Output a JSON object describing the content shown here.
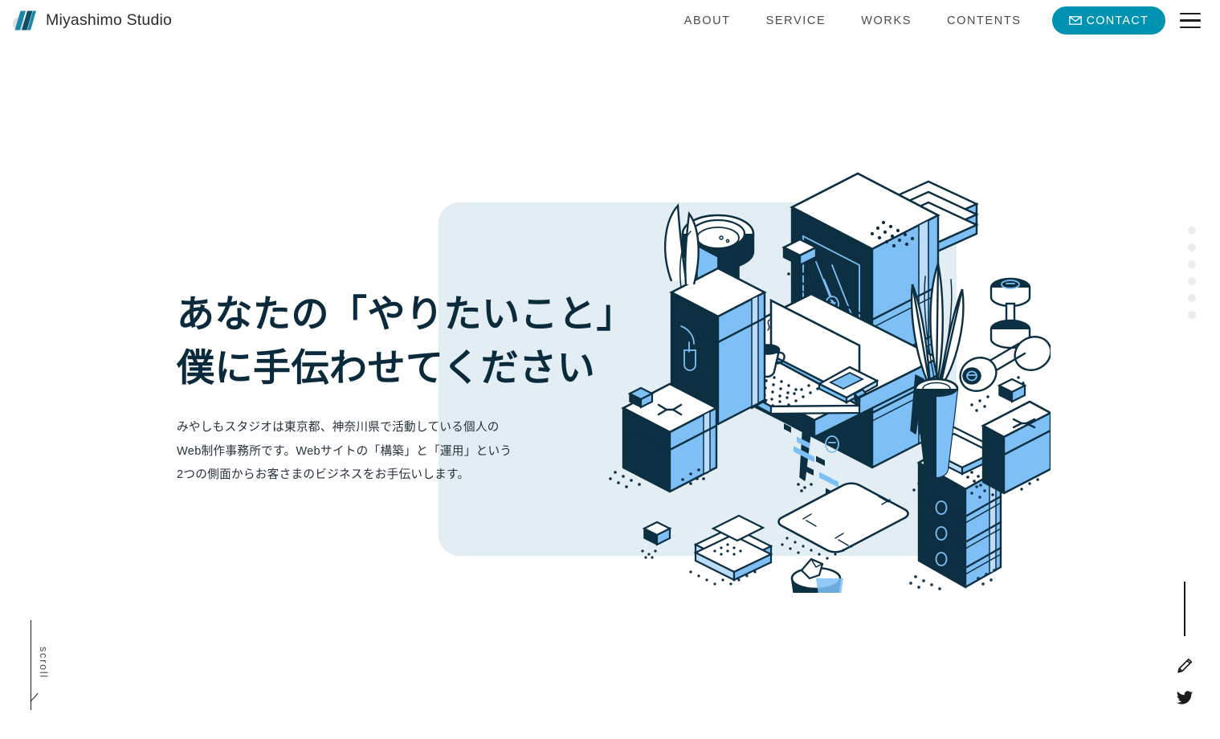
{
  "brand": {
    "name": "Miyashimo Studio",
    "logo_icon": "logo-slashes-icon",
    "accent": "#0092b1",
    "logo_circle": "#dedede"
  },
  "nav": {
    "items": [
      {
        "label": "ABOUT",
        "name": "nav-about"
      },
      {
        "label": "SERVICE",
        "name": "nav-service"
      },
      {
        "label": "WORKS",
        "name": "nav-works"
      },
      {
        "label": "CONTENTS",
        "name": "nav-contents"
      }
    ],
    "contact": {
      "label": "CONTACT",
      "icon": "envelope-icon",
      "bg": "#0092b1"
    },
    "menu_icon": "hamburger-menu-icon"
  },
  "hero": {
    "title_line1": "あなたの「やりたいこと」",
    "title_line2": "僕に手伝わせてください",
    "title_color": "#0b2b3c",
    "lead_line1": "みやしもスタジオは東京都、神奈川県で活動している個人の",
    "lead_line2": "Web制作事務所です。Webサイトの「構築」と「運用」という",
    "lead_line3": "2つの側面からお客さまのビジネスをお手伝いします。",
    "panel_color": "#e2eef3",
    "illustration_name": "isometric-workspace-illustration",
    "illustration_alt": "アイソメトリックのデスク・PC・サーバーラック・観葉植物のイラスト"
  },
  "side_nav": {
    "dots": [
      {
        "name": "section-dot-1"
      },
      {
        "name": "section-dot-2"
      },
      {
        "name": "section-dot-3"
      },
      {
        "name": "section-dot-4"
      },
      {
        "name": "section-dot-5"
      },
      {
        "name": "section-dot-6"
      }
    ],
    "dot_color": "#ececec"
  },
  "scroll_cue": {
    "label": "scroll"
  },
  "right_rail": {
    "icons": [
      {
        "name": "pencil-icon",
        "label": "blog"
      },
      {
        "name": "twitter-bird-icon",
        "label": "twitter"
      }
    ]
  },
  "palette": {
    "ink": "#0d2f42",
    "mid_blue": "#7ec0f5",
    "light_blue": "#bcdcfa",
    "panel": "#e2eef3",
    "white": "#ffffff"
  }
}
